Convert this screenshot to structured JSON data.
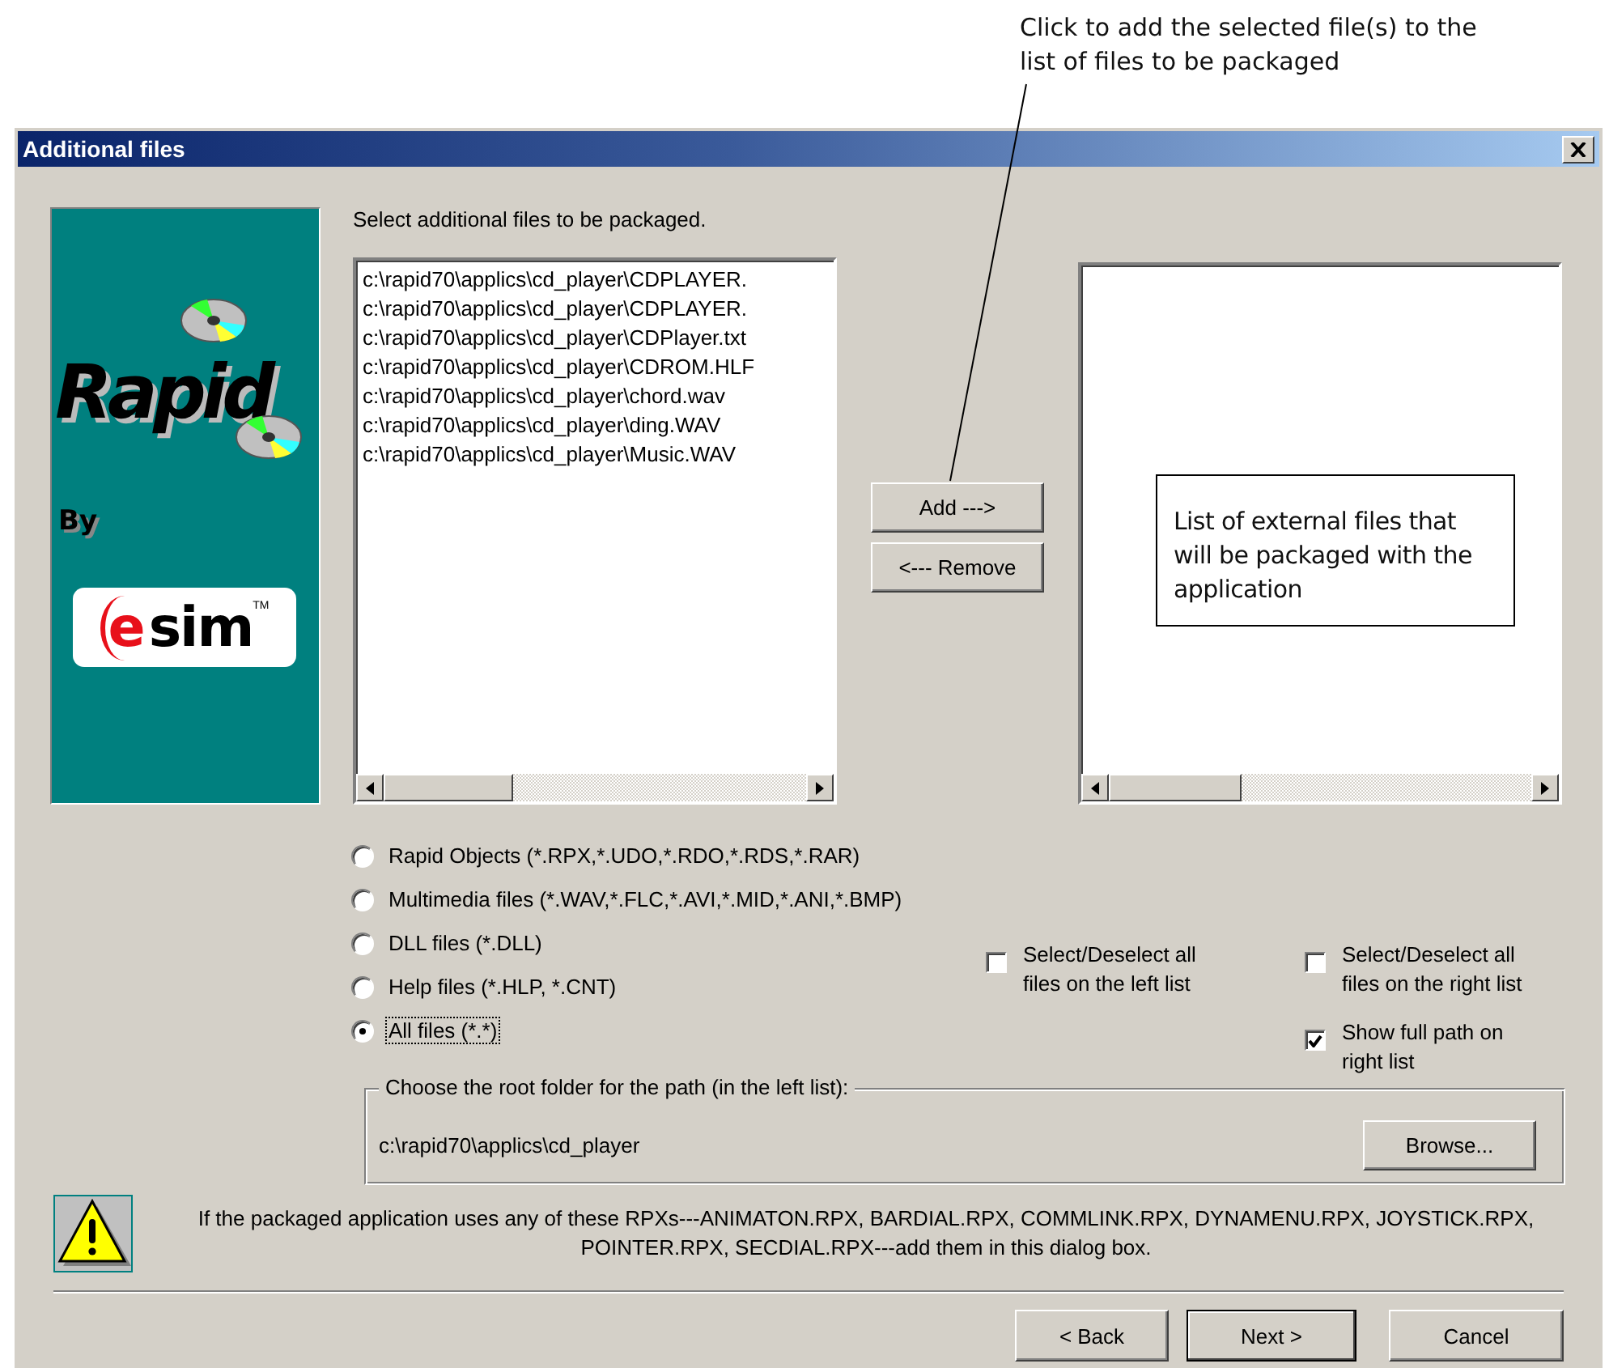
{
  "callouts": [
    {
      "kind": "leader",
      "text": "Click to add the selected file(s) to the list of files to be packaged"
    },
    {
      "kind": "boxed",
      "text": "List of external files that will be packaged with the application"
    }
  ],
  "window": {
    "title": "Additional files"
  },
  "logo": {
    "title": "Rapid",
    "by": "By",
    "brand_e": "e",
    "brand_rest": "sim",
    "trademark": "TM"
  },
  "left_list": {
    "label": "Select additional files to be packaged.",
    "items": [
      "c:\\rapid70\\applics\\cd_player\\CDPLAYER.",
      "c:\\rapid70\\applics\\cd_player\\CDPLAYER.",
      "c:\\rapid70\\applics\\cd_player\\CDPlayer.txt",
      "c:\\rapid70\\applics\\cd_player\\CDROM.HLF",
      "c:\\rapid70\\applics\\cd_player\\chord.wav",
      "c:\\rapid70\\applics\\cd_player\\ding.WAV",
      "c:\\rapid70\\applics\\cd_player\\Music.WAV"
    ]
  },
  "move_buttons": [
    "Add --->",
    "<--- Remove"
  ],
  "file_types": [
    {
      "label": "Rapid Objects (*.RPX,*.UDO,*.RDO,*.RDS,*.RAR)",
      "selected": false
    },
    {
      "label": "Multimedia files (*.WAV,*.FLC,*.AVI,*.MID,*.ANI,*.BMP)",
      "selected": false
    },
    {
      "label": "DLL files (*.DLL)",
      "selected": false
    },
    {
      "label": "Help files (*.HLP, *.CNT)",
      "selected": false
    },
    {
      "label": "All files (*.*)",
      "selected": true
    }
  ],
  "left_options": [
    {
      "label": "Select/Deselect all files on the left list",
      "checked": false
    }
  ],
  "right_options": [
    {
      "label": "Select/Deselect all files on the right list",
      "checked": false
    },
    {
      "label": "Show full path on right list",
      "checked": true
    }
  ],
  "root_folder": {
    "legend": "Choose the root folder for the path (in the left list):",
    "path": "c:\\rapid70\\applics\\cd_player",
    "button": "Browse..."
  },
  "warning": "If the packaged application uses any of these RPXs---ANIMATON.RPX, BARDIAL.RPX, COMMLINK.RPX, DYNAMENU.RPX, JOYSTICK.RPX, POINTER.RPX, SECDIAL.RPX---add them in this dialog box.",
  "footer_buttons": [
    {
      "label": "< Back",
      "default": false
    },
    {
      "label": "Next >",
      "default": true
    },
    {
      "label": "Cancel",
      "default": false
    }
  ]
}
